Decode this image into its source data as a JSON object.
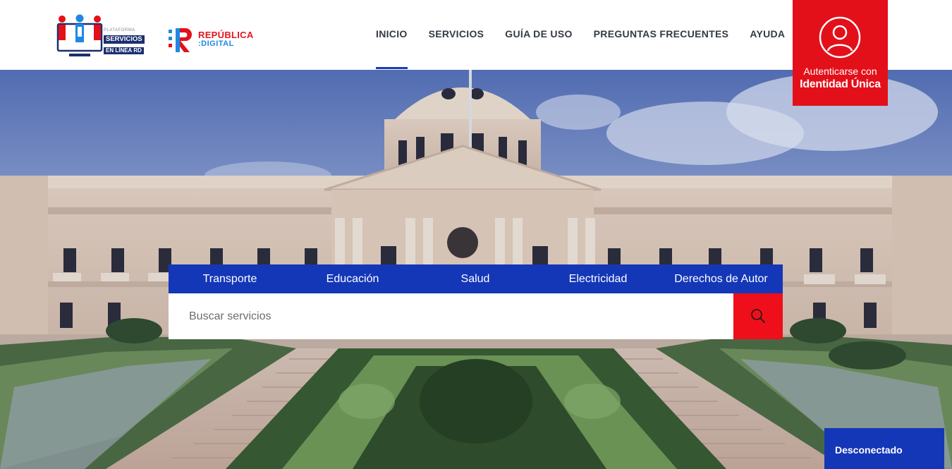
{
  "header": {
    "logo_servicios": {
      "line1": "PLATAFORMA",
      "line2": "SERVICIOS",
      "line3": "EN LÍNEA",
      "suffix": "RD"
    },
    "logo_republica": {
      "line1": "REPÚBLICA",
      "line2": ":DIGITAL"
    },
    "nav": [
      {
        "label": "INICIO",
        "active": true
      },
      {
        "label": "SERVICIOS",
        "active": false
      },
      {
        "label": "GUÍA DE USO",
        "active": false
      },
      {
        "label": "PREGUNTAS FRECUENTES",
        "active": false
      },
      {
        "label": "AYUDA",
        "active": false
      }
    ],
    "auth": {
      "line1": "Autenticarse con",
      "line2": "Identidad Única",
      "icon": "user-icon"
    }
  },
  "categories": [
    "Transporte",
    "Educación",
    "Salud",
    "Electricidad",
    "Derechos de Autor"
  ],
  "search": {
    "placeholder": "Buscar servicios",
    "button_icon": "search-icon"
  },
  "status": {
    "label": "Desconectado"
  },
  "colors": {
    "brand_blue": "#1437b8",
    "brand_red": "#e3101a",
    "nav_text": "#333a45"
  }
}
